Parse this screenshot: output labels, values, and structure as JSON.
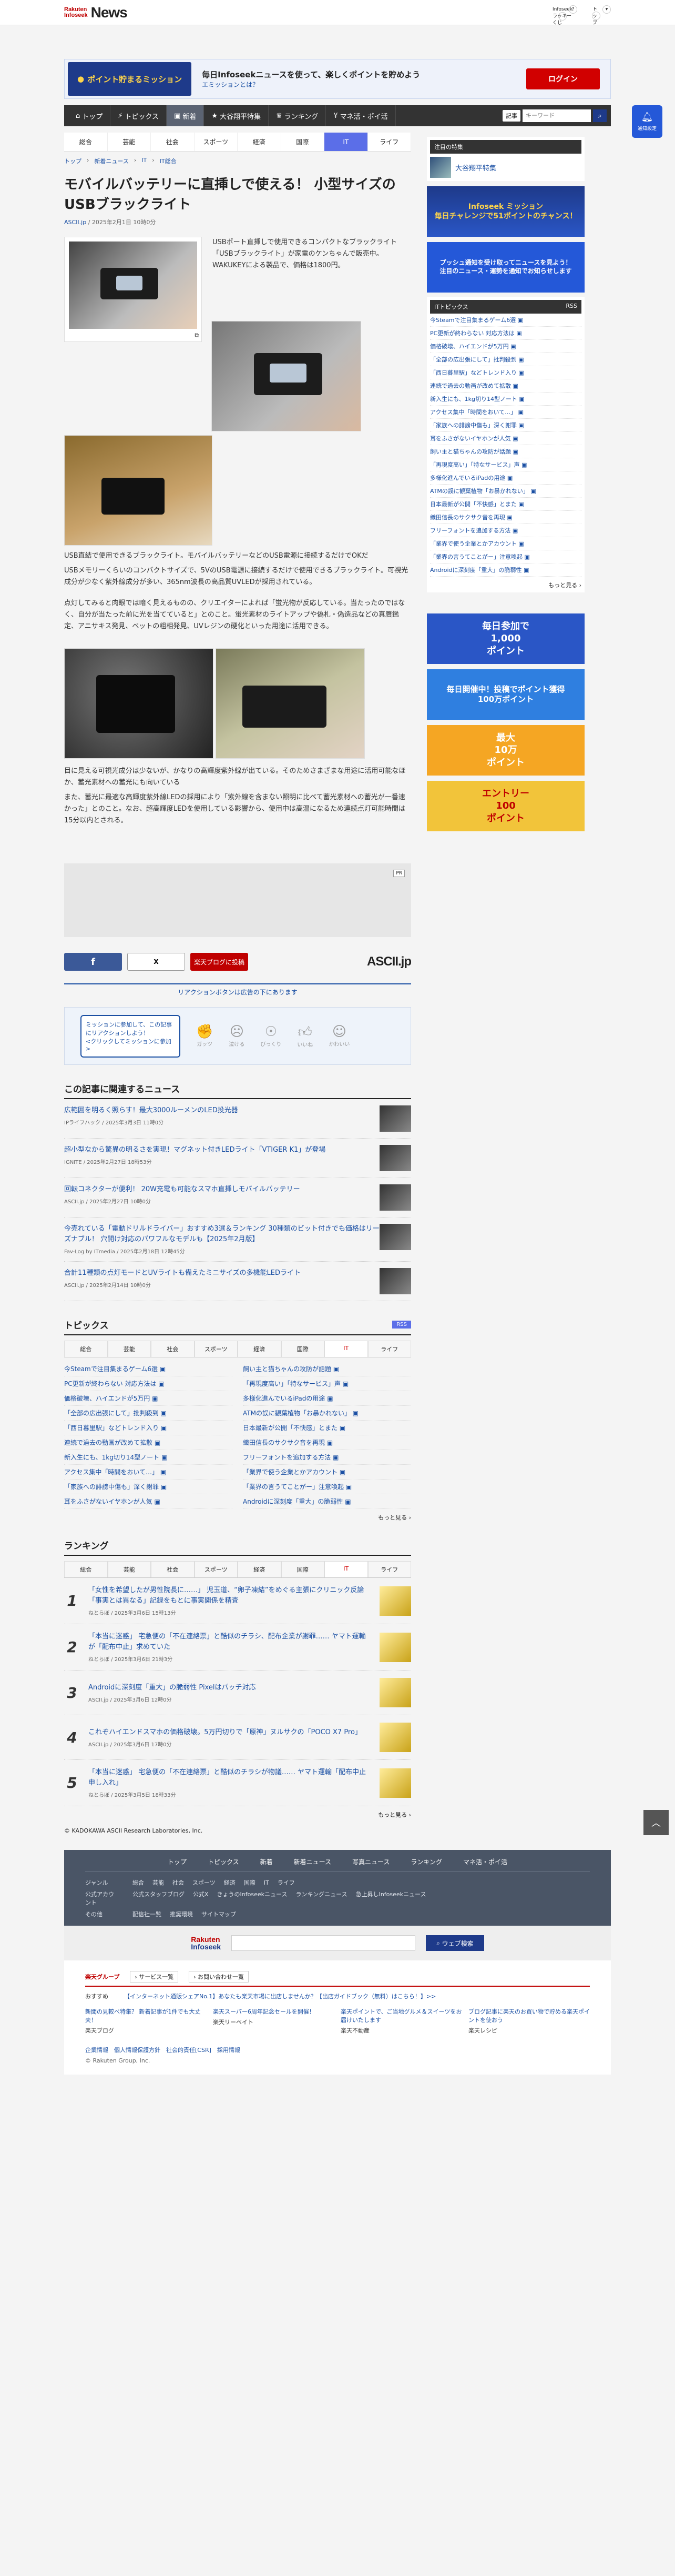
{
  "header": {
    "logo_small": "Rakuten\nInfoseek",
    "logo_news": "News",
    "user": "Infoseekラッキーくじ",
    "top": "トップ"
  },
  "mission": {
    "badge": "ポイント貯まるミッション",
    "headline": "毎日Infoseekニュースを使って、楽しくポイントを貯めよう",
    "link": "エミッションとは？",
    "login": "ログイン"
  },
  "nav": {
    "items": [
      "トップ",
      "トピックス",
      "新着",
      "大谷翔平特集",
      "ランキング",
      "マネ活・ポイ活"
    ],
    "active_index": 2,
    "search_select": "記事",
    "search_placeholder": "キーワード"
  },
  "notify": "通知設定",
  "categories": [
    "総合",
    "芸能",
    "社会",
    "スポーツ",
    "経済",
    "国際",
    "IT",
    "ライフ"
  ],
  "active_cat": "IT",
  "breadcrumb": [
    "トップ",
    "新着ニュース",
    "IT",
    "IT総合"
  ],
  "article": {
    "title": "モバイルバッテリーに直挿しで使える！ 小型サイズのUSBブラックライト",
    "source": "ASCII.jp",
    "date": "/ 2025年2月1日 10時0分",
    "p1": "USBポート直挿しで使用できるコンパクトなブラックライト「USBブラックライト」が家電のケンちゃんで販売中。WAKUKEYによる製品で、価格は1800円。",
    "caption1": "USB直結で使用できるブラックライト。モバイルバッテリーなどのUSB電源に接続するだけでOKだ",
    "p2": "USBメモリーくらいのコンパクトサイズで、5VのUSB電源に接続するだけで使用できるブラックライト。可視光成分が少なく紫外線成分が多い、365nm波長の高品質UVLEDが採用されている。",
    "p3": "点灯してみると肉眼では暗く見えるものの、クリエイターによれば「蛍光物が反応している。当たったのではなく、自分が当たった前に光を当てていると」とのこと。蛍光素材のライトアップや偽札・偽造品などの真贋鑑定、アニサキス発見、ペットの粗相発見、UVレジンの硬化といった用途に活用できる。",
    "caption2": "目に見える可視光成分は少ないが、かなりの高輝度紫外線が出ている。そのためさまざまな用途に活用可能なほか、蓄光素材への蓄光にも向いている",
    "p4": "また、蓄光に最適な高輝度紫外線LEDの採用により「紫外線を含まない照明に比べて蓄光素材への蓄光が一番速かった」とのこと。なお、超高輝度LEDを使用している影響から、使用中は高温になるため連続点灯可能時間は15分以内とされる。"
  },
  "share": {
    "facebook": "f",
    "x": "X",
    "blog": "楽天ブログに投稿",
    "ascii": "ASCII.jp"
  },
  "reaction": {
    "bar": "リアクションボタンは広告の下にあります",
    "bubble": "ミッションに参加して、この記事にリアクションしよう！\n<クリックしてミッションに参加>",
    "buttons": [
      "ガッツ",
      "泣ける",
      "びっくり",
      "いいね",
      "かわいい"
    ]
  },
  "ad_label": "PR",
  "related": {
    "heading": "この記事に関連するニュース",
    "items": [
      {
        "title": "広範囲を明るく照らす！最大3000ルーメンのLED投光器",
        "source": "IPライフハック / 2025年3月3日 11時0分"
      },
      {
        "title": "超小型なから驚異の明るさを実現！マグネット付きLEDライト「VTIGER K1」が登場",
        "source": "IGNITE / 2025年2月27日 18時53分"
      },
      {
        "title": "回転コネクターが便利！ 20W充電も可能なスマホ直挿しモバイルバッテリー",
        "source": "ASCII.jp / 2025年2月27日 10時0分"
      },
      {
        "title": "今売れている「電動ドリルドライバー」おすすめ3選＆ランキング 30種類のビット付きでも価格はリーズナブル！ 穴開け対応のパワフルなモデルも【2025年2月版】",
        "source": "Fav-Log by ITmedia / 2025年2月18日 12時45分"
      },
      {
        "title": "合計11種類の点灯モードとUVライトも備えたミニサイズの多機能LEDライト",
        "source": "ASCII.jp / 2025年2月14日 10時0分"
      }
    ]
  },
  "topics": {
    "heading": "トピックス",
    "rss": "RSS",
    "tabs": [
      "総合",
      "芸能",
      "社会",
      "スポーツ",
      "経済",
      "国際",
      "IT",
      "ライフ"
    ],
    "active": "IT",
    "items": [
      "今Steamで注目集まるゲーム6選",
      "飼い主と猫ちゃんの攻防が話題",
      "PC更新が終わらない 対応方法は",
      "「再現度高い」「特なサービス」声",
      "価格破壊、ハイエンドが5万円",
      "多様化進んでいるiPadの用途",
      "「全部の広出張にして」批判殺到",
      "ATMの誤に観葉植物「お暴かれない」",
      "「西日暮里駅」などトレンド入り",
      "日本最新が公開「不快感」とまた",
      "連続で過去の動画が改めて拡散",
      "織田信長のサクサク音を再現",
      "新入生にも、1kg切り14型ノート",
      "フリーフォントを追加する方法",
      "アクセス集中「時間をおいて…」",
      "「業界で使う企業とかアカウント",
      "「家族への誹謗中傷も」深く謝罪",
      "「業界の言うてことがー」注意喚起",
      "耳をふさがないイヤホンが人気",
      "Androidに深刻度「重大」の脆弱性"
    ],
    "more": "もっと見る"
  },
  "ranking": {
    "heading": "ランキング",
    "tabs": [
      "総合",
      "芸能",
      "社会",
      "スポーツ",
      "経済",
      "国際",
      "IT",
      "ライフ"
    ],
    "active": "IT",
    "items": [
      {
        "n": "1",
        "title": "「女性を希望したが男性院長に……」 児玉道、“卵子凍結”をめぐる主張にクリニック反論 「事実とは異なる」記録をもとに事実関係を精査",
        "source": "ねとらぼ / 2025年3月6日 15時13分"
      },
      {
        "n": "2",
        "title": "「本当に迷惑」 宅急便の「不在連絡票」と酷似のチラシ、配布企業が謝罪…… ヤマト運輸が「配布中止」求めていた",
        "source": "ねとらぼ / 2025年3月6日 21時3分"
      },
      {
        "n": "3",
        "title": "Androidに深刻度「重大」の脆弱性 Pixelはパッチ対応",
        "source": "ASCII.jp / 2025年3月6日 12時0分"
      },
      {
        "n": "4",
        "title": "これぞハイエンドスマホの価格破壊。5万円切りで「原神」ヌルサクの「POCO X7 Pro」",
        "source": "ASCII.jp / 2025年3月6日 17時0分"
      },
      {
        "n": "5",
        "title": "「本当に迷惑」 宅急便の「不在連絡票」と酷似のチラシが物議…… ヤマト運輸「配布中止申し入れ」",
        "source": "ねとらぼ / 2025年3月5日 18時33分"
      }
    ],
    "more": "もっと見る"
  },
  "copyright": "© KADOKAWA ASCII Research Laboratories, Inc.",
  "right": {
    "special": "注目の特集",
    "special_item": "大谷翔平特集",
    "mission_ad": "Infoseek ミッション\n毎日チャレンジで51ポイントのチャンス！",
    "push_ad": "プッシュ通知を受け取ってニュースを見よう！\n注目のニュース・運勢を通知でお知らせします",
    "it_topics": "ITトピックス",
    "rss": "RSS",
    "list": [
      "今Steamで注目集まるゲーム6選",
      "PC更新が終わらない 対応方法は",
      "価格破壊、ハイエンドが5万円",
      "「全部の広出張にして」批判殺到",
      "「西日暮里駅」などトレンド入り",
      "連続で過去の動画が改めて拡散",
      "新入生にも、1kg切り14型ノート",
      "アクセス集中「時間をおいて…」",
      "「家族への誹謗中傷も」深く謝罪",
      "耳をふさがないイヤホンが人気",
      "飼い主と猫ちゃんの攻防が話題",
      "「再現度高い」「特なサービス」声",
      "多様化進んでいるiPadの用途",
      "ATMの誤に観葉植物「お暴かれない」",
      "日本最新が公開「不快感」とまた",
      "織田信長のサクサク音を再現",
      "フリーフォントを追加する方法",
      "「業界で使う企業とかアカウント",
      "「業界の言うてことがー」注意喚起",
      "Androidに深刻度「重大」の脆弱性"
    ],
    "more": "もっと見る",
    "ads": [
      "毎日参加で\n1,000\nポイント",
      "毎日開催中！投稿でポイント獲得\n100万ポイント",
      "最大\n10万\nポイント",
      "エントリー\n100\nポイント"
    ]
  },
  "footer": {
    "nav": [
      "トップ",
      "トピックス",
      "新着",
      "新着ニュース",
      "写真ニュース",
      "ランキング",
      "マネ活・ポイ活"
    ],
    "genre_label": "ジャンル",
    "genres": [
      "総合",
      "芸能",
      "社会",
      "スポーツ",
      "経済",
      "国際",
      "IT",
      "ライフ"
    ],
    "official_label": "公式アカウント",
    "official": [
      "公式スタッフブログ",
      "公式X",
      "きょうのInfoseekニュース",
      "ランキングニュース",
      "急上昇しInfoseekニュース"
    ],
    "other_label": "その他",
    "other": [
      "配信社一覧",
      "推奨環境",
      "サイトマップ"
    ],
    "search_btn": "ウェブ検索",
    "group": "楽天グループ",
    "svc_list": "サービス一覧",
    "contact": "お問い合わせ一覧",
    "recommend": "おすすめ",
    "promo": "【インターネット通販シェアNo.1】あなたも楽天市場に出店しませんか？【出店ガイドブック（無料）はこちら！】>>",
    "services": [
      "新聞の見較べ特集？ 新着記事が1件でも大丈夫！",
      "楽天スーパー6周年記念セールを開催！",
      "楽天ポイントで、ご当地グルメ＆スイーツをお届けいたします",
      "ブログ記事に楽天のお買い物で貯める楽天ポイントを使おう"
    ],
    "svc_sub": [
      "楽天ブログ",
      "楽天リーベイト",
      "楽天不動産",
      "楽天レシピ"
    ],
    "links": "企業情報　個人情報保護方針　社会的責任[CSR]　採用情報",
    "copy": "© Rakuten Group, Inc."
  }
}
